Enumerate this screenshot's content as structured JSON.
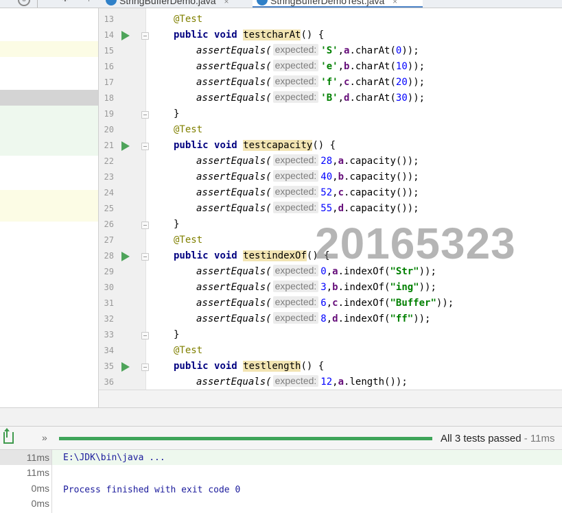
{
  "tabs": [
    {
      "label": "StringBufferDemo.java",
      "active": false
    },
    {
      "label": "StringBufferDemoTest.java",
      "active": true
    }
  ],
  "tab_close_glyph": "×",
  "editor": {
    "lines": [
      {
        "n": "13",
        "kind": "ann",
        "text": "@Test"
      },
      {
        "n": "14",
        "kind": "sig",
        "method": "testcharAt",
        "run": true
      },
      {
        "n": "15",
        "kind": "assert",
        "expected": "'S'",
        "vtype": "str",
        "field": "a",
        "call": ".charAt(",
        "arg": "0",
        "argtype": "num",
        "tail": "));"
      },
      {
        "n": "16",
        "kind": "assert",
        "expected": "'e'",
        "vtype": "str",
        "field": "b",
        "call": ".charAt(",
        "arg": "10",
        "argtype": "num",
        "tail": "));"
      },
      {
        "n": "17",
        "kind": "assert",
        "expected": "'f'",
        "vtype": "str",
        "field": "c",
        "call": ".charAt(",
        "arg": "20",
        "argtype": "num",
        "tail": "));"
      },
      {
        "n": "18",
        "kind": "assert",
        "expected": "'B'",
        "vtype": "str",
        "field": "d",
        "call": ".charAt(",
        "arg": "30",
        "argtype": "num",
        "tail": "));"
      },
      {
        "n": "19",
        "kind": "close",
        "text": "}"
      },
      {
        "n": "20",
        "kind": "ann",
        "text": "@Test"
      },
      {
        "n": "21",
        "kind": "sig",
        "method": "testcapacity",
        "run": true
      },
      {
        "n": "22",
        "kind": "assert",
        "expected": "28",
        "vtype": "num",
        "field": "a",
        "call": ".capacity(",
        "arg": "",
        "argtype": "num",
        "tail": "));"
      },
      {
        "n": "23",
        "kind": "assert",
        "expected": "40",
        "vtype": "num",
        "field": "b",
        "call": ".capacity(",
        "arg": "",
        "argtype": "num",
        "tail": "));"
      },
      {
        "n": "24",
        "kind": "assert",
        "expected": "52",
        "vtype": "num",
        "field": "c",
        "call": ".capacity(",
        "arg": "",
        "argtype": "num",
        "tail": "));"
      },
      {
        "n": "25",
        "kind": "assert",
        "expected": "55",
        "vtype": "num",
        "field": "d",
        "call": ".capacity(",
        "arg": "",
        "argtype": "num",
        "tail": "));"
      },
      {
        "n": "26",
        "kind": "close",
        "text": "}"
      },
      {
        "n": "27",
        "kind": "ann",
        "text": "@Test"
      },
      {
        "n": "28",
        "kind": "sig",
        "method": "testindexOf",
        "run": true
      },
      {
        "n": "29",
        "kind": "assert",
        "expected": "0",
        "vtype": "num",
        "field": "a",
        "call": ".indexOf(",
        "arg": "\"Str\"",
        "argtype": "str",
        "tail": "));"
      },
      {
        "n": "30",
        "kind": "assert",
        "expected": "3",
        "vtype": "num",
        "field": "b",
        "call": ".indexOf(",
        "arg": "\"ing\"",
        "argtype": "str",
        "tail": "));"
      },
      {
        "n": "31",
        "kind": "assert",
        "expected": "6",
        "vtype": "num",
        "field": "c",
        "call": ".indexOf(",
        "arg": "\"Buffer\"",
        "argtype": "str",
        "tail": "));"
      },
      {
        "n": "32",
        "kind": "assert",
        "expected": "8",
        "vtype": "num",
        "field": "d",
        "call": ".indexOf(",
        "arg": "\"ff\"",
        "argtype": "str",
        "tail": "));"
      },
      {
        "n": "33",
        "kind": "close",
        "text": "}"
      },
      {
        "n": "34",
        "kind": "ann",
        "text": "@Test"
      },
      {
        "n": "35",
        "kind": "sig",
        "method": "testlength",
        "run": true
      },
      {
        "n": "36",
        "kind": "assert",
        "expected": "12",
        "vtype": "num",
        "field": "a",
        "call": ".length(",
        "arg": "",
        "argtype": "num",
        "tail": "));"
      }
    ],
    "keyword_public": "public",
    "keyword_void": "void",
    "sig_tail": "() {",
    "assert_fn": "assertEquals(",
    "hint_label": "expected:",
    "comma": ","
  },
  "watermark": "20165323",
  "run_panel": {
    "chevron": "»",
    "progress": 1.0,
    "status": "All 3 tests passed",
    "duration": " - 11ms",
    "times": [
      "11ms",
      "11ms",
      "0ms",
      "0ms"
    ],
    "console": [
      "E:\\JDK\\bin\\java ...",
      "",
      "Process finished with exit code 0"
    ]
  },
  "colors": {
    "run_green": "#4ea45a",
    "progress_green": "#3fa55a",
    "annotation": "#808000",
    "keyword": "#000080",
    "string": "#008000",
    "number": "#0000ff",
    "field": "#660e7a"
  }
}
